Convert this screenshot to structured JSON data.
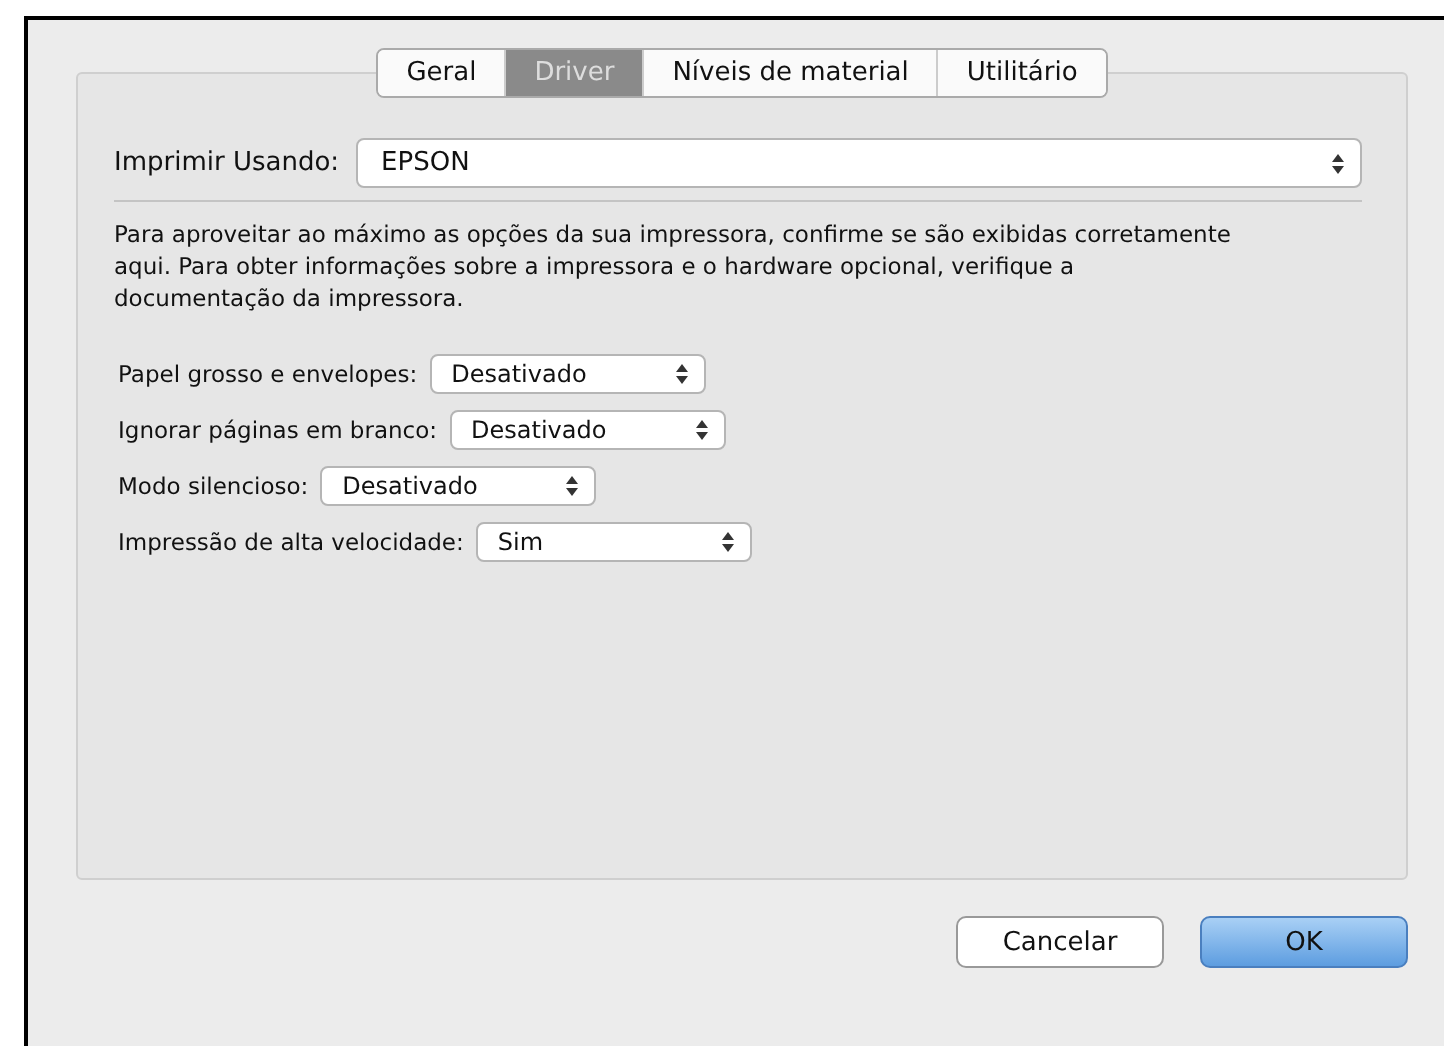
{
  "tabs": [
    {
      "label": "Geral",
      "selected": false
    },
    {
      "label": "Driver",
      "selected": true
    },
    {
      "label": "Níveis de material",
      "selected": false
    },
    {
      "label": "Utilitário",
      "selected": false
    }
  ],
  "printer": {
    "label": "Imprimir Usando:",
    "value": "EPSON"
  },
  "description": "Para aproveitar ao máximo as opções da sua impressora, confirme se são exibidas corretamente aqui. Para obter informações sobre a impressora e o hardware opcional, verifique a documentação da impressora.",
  "options": [
    {
      "label": "Papel grosso e envelopes:",
      "value": "Desativado"
    },
    {
      "label": "Ignorar páginas em branco:",
      "value": "Desativado"
    },
    {
      "label": "Modo silencioso:",
      "value": "Desativado"
    },
    {
      "label": "Impressão de alta velocidade:",
      "value": "Sim"
    }
  ],
  "buttons": [
    {
      "label": "Cancelar",
      "default": false
    },
    {
      "label": "OK",
      "default": true
    }
  ]
}
